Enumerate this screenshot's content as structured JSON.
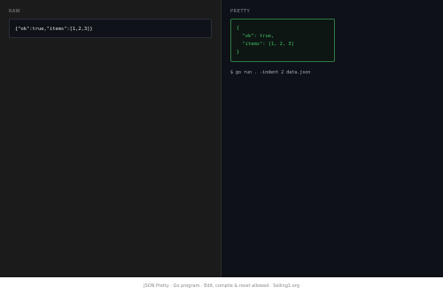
{
  "raw": {
    "label": "RAW",
    "input_value": "{\"ok\":true,\"items\":[1,2,3]}"
  },
  "pretty": {
    "label": "PRETTY",
    "lines": [
      "{",
      "  \"ok\": true,",
      "  \"items\": [1, 2, 3]",
      "}"
    ],
    "command": "$ go run . -indent 2 data.json"
  },
  "footer": {
    "text": "JSON Pretty · Go program · Edit, compile & reset allowed · Selling1.org"
  },
  "colors": {
    "left_bg": "#1c1b1c",
    "right_bg": "#0e1117",
    "accent_green": "#41c464",
    "box_border_green": "#2c7b45"
  }
}
